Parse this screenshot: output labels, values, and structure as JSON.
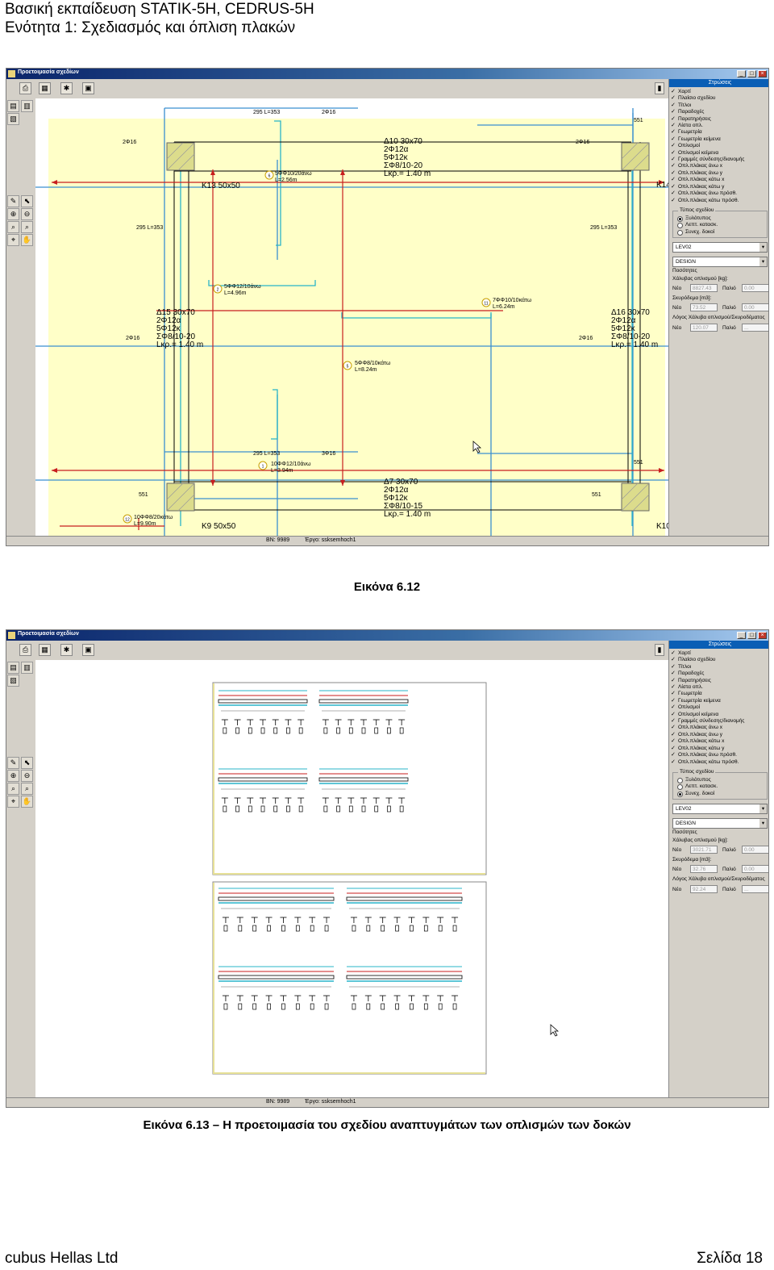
{
  "header": {
    "line1": "Βασική εκπαίδευση STATIK-5H, CEDRUS-5H",
    "line2": "Ενότητα 1: Σχεδιασμός και όπλιση πλακών"
  },
  "window": {
    "title": "Προετοιμασία σχεδίων",
    "status_bn": "BN: 9989",
    "status_project": "Έργο: ssksemhoch1"
  },
  "panel": {
    "title": "Στρώσεις",
    "layers": [
      "Χαρτί",
      "Πλαίσιο σχεδίου",
      "Τίτλοι",
      "Παραδοχές",
      "Παρατηρήσεις",
      "Λίστα οπλ.",
      "Γεωμετρία",
      "Γεωμετρία κείμενα",
      "Οπλισμοί",
      "Οπλισμοί κείμενα",
      "Γραμμές σύνδεσης/διανομής",
      "Οπλ.πλάκας άνω x",
      "Οπλ.πλάκας άνω y",
      "Οπλ.πλάκας κάτω x",
      "Οπλ.πλάκας κάτω y",
      "Οπλ.πλάκας άνω πρόσθ.",
      "Οπλ.πλάκας κάτω πρόσθ."
    ],
    "drawing_type_title": "Τύπος σχεδίου",
    "drawing_types": [
      "Ξυλότυπος",
      "Λεπτ. κατασκ.",
      "Συνεχ. δοκοί"
    ],
    "select_level": "LEV02",
    "select_design": "DESIGN",
    "quantities_title": "Ποσότητες",
    "steel_label": "Χάλυβας οπλισμού [kg]:",
    "concrete_label": "Σκυρόδεμα [m3]:",
    "ratio_label": "Λόγος Χάλυβα οπλισμού/Σκυροδέματος",
    "new_label": "Νέο",
    "old_label": "Παλιό"
  },
  "figure1": {
    "selected_type": 0,
    "steel_new": "8827.43",
    "steel_old": "0.00",
    "concrete_new": "73.52",
    "concrete_old": "0.00",
    "ratio_new": "120.07",
    "ratio_old": "...",
    "labels": {
      "top_beam": "295 L=353",
      "top_2d16": "2Φ16",
      "top_2d16b": "2Φ16",
      "top_2d16c": "2Φ16",
      "top_551": "551",
      "d10_title": "Δ10 30x70",
      "d10_l1": "2Φ12α",
      "d10_l2": "5Φ12κ",
      "d10_l3": "ΣΦ8/10-20",
      "d10_l4": "Lκρ.= 1.40 m",
      "k13": "K13 50x50",
      "k14": "K14",
      "k9": "K9 50x50",
      "k10": "K10",
      "bar6_a": "5ΦΦ10/20άνω",
      "bar6_b": "L=2.56m",
      "left_295": "295 L=353",
      "right_295": "295 L=353",
      "bar2_a": "5ΦΦ12/10άνω",
      "bar2_b": "L=4.96m",
      "bar11_a": "7ΦΦ10/10κάτω",
      "bar11_b": "L=6.24m",
      "d15_title": "Δ15 30x70",
      "d15_l1": "2Φ12α",
      "d15_l2": "5Φ12κ",
      "d15_l3": "ΣΦ8/10-20",
      "d15_l4": "Lκρ.= 1.40 m",
      "d16_title": "Δ16 30x70",
      "d16_l1": "2Φ12α",
      "d16_l2": "5Φ12κ",
      "d16_l3": "ΣΦ8/10-20",
      "d16_l4": "Lκρ.= 1.40 m",
      "left_2d16": "2Φ16",
      "right_2d16": "2Φ16",
      "bar5_a": "5ΦΦ8/10κάτω",
      "bar5_b": "L=8.24m",
      "bot_295": "295 L=353",
      "bot_3d16": "3Φ16",
      "bar1_a": "10ΦΦ12/10άνω",
      "bar1_b": "L=3.94m",
      "d7_title": "Δ7 30x70",
      "d7_l1": "2Φ12α",
      "d7_l2": "5Φ12κ",
      "d7_l3": "ΣΦ8/10-15",
      "d7_l4": "Lκρ.= 1.40 m",
      "left_551": "551",
      "mid_551": "551",
      "right_551": "551",
      "bar12_a": "10ΦΦ8/20κάτω",
      "bar12_b": "L=9.90m",
      "n6": "6",
      "n2": "2",
      "n11": "11",
      "n5": "5",
      "n1": "1",
      "n12": "12"
    }
  },
  "caption1": "Εικόνα 6.12",
  "figure2": {
    "selected_type": 2,
    "steel_new": "3021.71",
    "steel_old": "0.00",
    "concrete_new": "32.76",
    "concrete_old": "0.00",
    "ratio_new": "92.24",
    "ratio_old": "..."
  },
  "caption2": "Εικόνα 6.13 – Η προετοιμασία του σχεδίου αναπτυγμάτων των οπλισμών των δοκών",
  "footer": {
    "company": "cubus Hellas Ltd",
    "page": "Σελίδα 18"
  },
  "colors": {
    "canvas_yellow": "#ffffc8",
    "beam_red": "#c81e1e",
    "rebar_cyan": "#28b4c8",
    "axis_blue": "#3264c8",
    "column_fill": "#dcdc8c"
  }
}
